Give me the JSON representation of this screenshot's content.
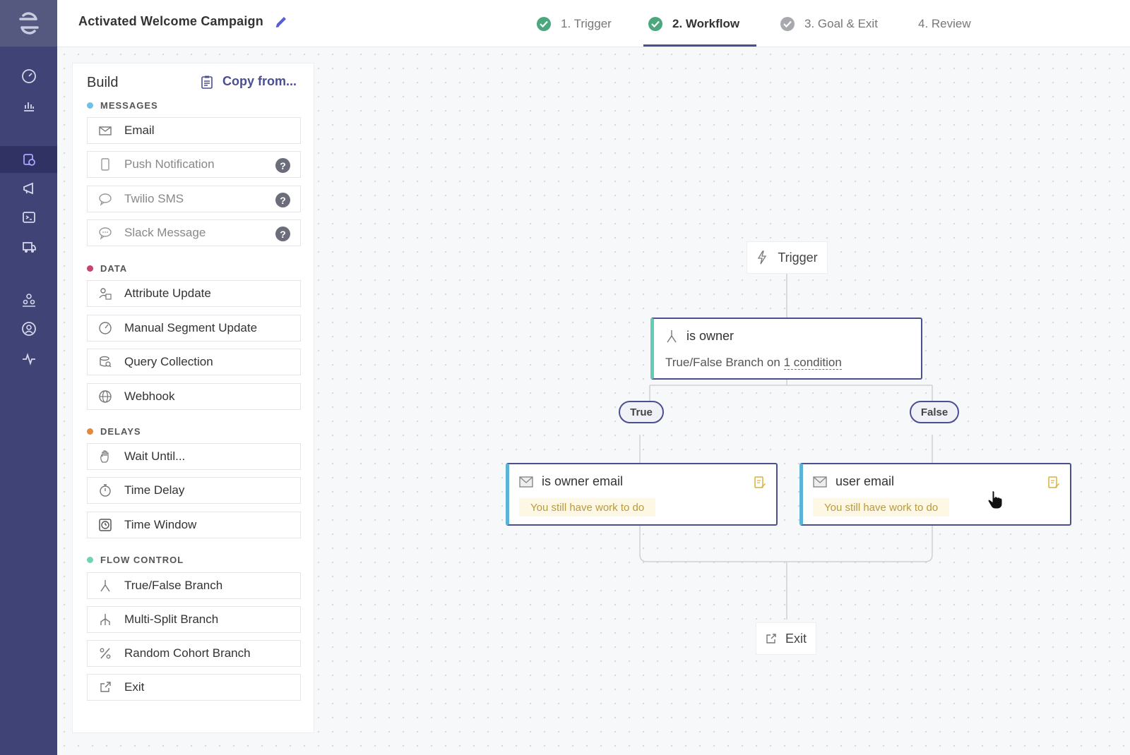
{
  "header": {
    "campaign_title": "Activated Welcome Campaign",
    "steps": [
      {
        "label": "1. Trigger",
        "state": "complete"
      },
      {
        "label": "2. Workflow",
        "state": "active"
      },
      {
        "label": "3. Goal & Exit",
        "state": "partial"
      },
      {
        "label": "4. Review",
        "state": "pending"
      }
    ]
  },
  "nav": {
    "icons": [
      "segment-logo-icon",
      "dashboard-icon",
      "bar-chart-icon",
      "journeys-icon",
      "megaphone-icon",
      "terminal-icon",
      "delivery-icon",
      "people-icon",
      "user-circle-icon",
      "activity-icon"
    ]
  },
  "build": {
    "title": "Build",
    "copy_from": "Copy from...",
    "sections": {
      "messages": "MESSAGES",
      "data": "DATA",
      "delays": "DELAYS",
      "flow_control": "FLOW CONTROL"
    },
    "items": {
      "email": "Email",
      "push": "Push Notification",
      "sms": "Twilio SMS",
      "slack": "Slack Message",
      "attribute_update": "Attribute Update",
      "manual_segment": "Manual Segment Update",
      "query_collection": "Query Collection",
      "webhook": "Webhook",
      "wait_until": "Wait Until...",
      "time_delay": "Time Delay",
      "time_window": "Time Window",
      "true_false": "True/False Branch",
      "multi_split": "Multi-Split Branch",
      "random_cohort": "Random Cohort Branch",
      "exit": "Exit"
    },
    "help_glyph": "?"
  },
  "workflow": {
    "trigger": "Trigger",
    "branch": {
      "title": "is owner",
      "sub_prefix": "True/False Branch on ",
      "sub_condition": "1 condition"
    },
    "true_label": "True",
    "false_label": "False",
    "email_left": {
      "title": "is owner email",
      "warning": "You still have work to do"
    },
    "email_right": {
      "title": "user email",
      "warning": "You still have work to do"
    },
    "exit": "Exit"
  },
  "colors": {
    "nav_bg": "#3f4375",
    "accent": "#4b4e8f",
    "check_green": "#4aa77e",
    "messages_dot": "#6fc2e3",
    "data_dot": "#c8446a",
    "delays_dot": "#e08a3c",
    "flow_dot": "#6fd4b5"
  }
}
